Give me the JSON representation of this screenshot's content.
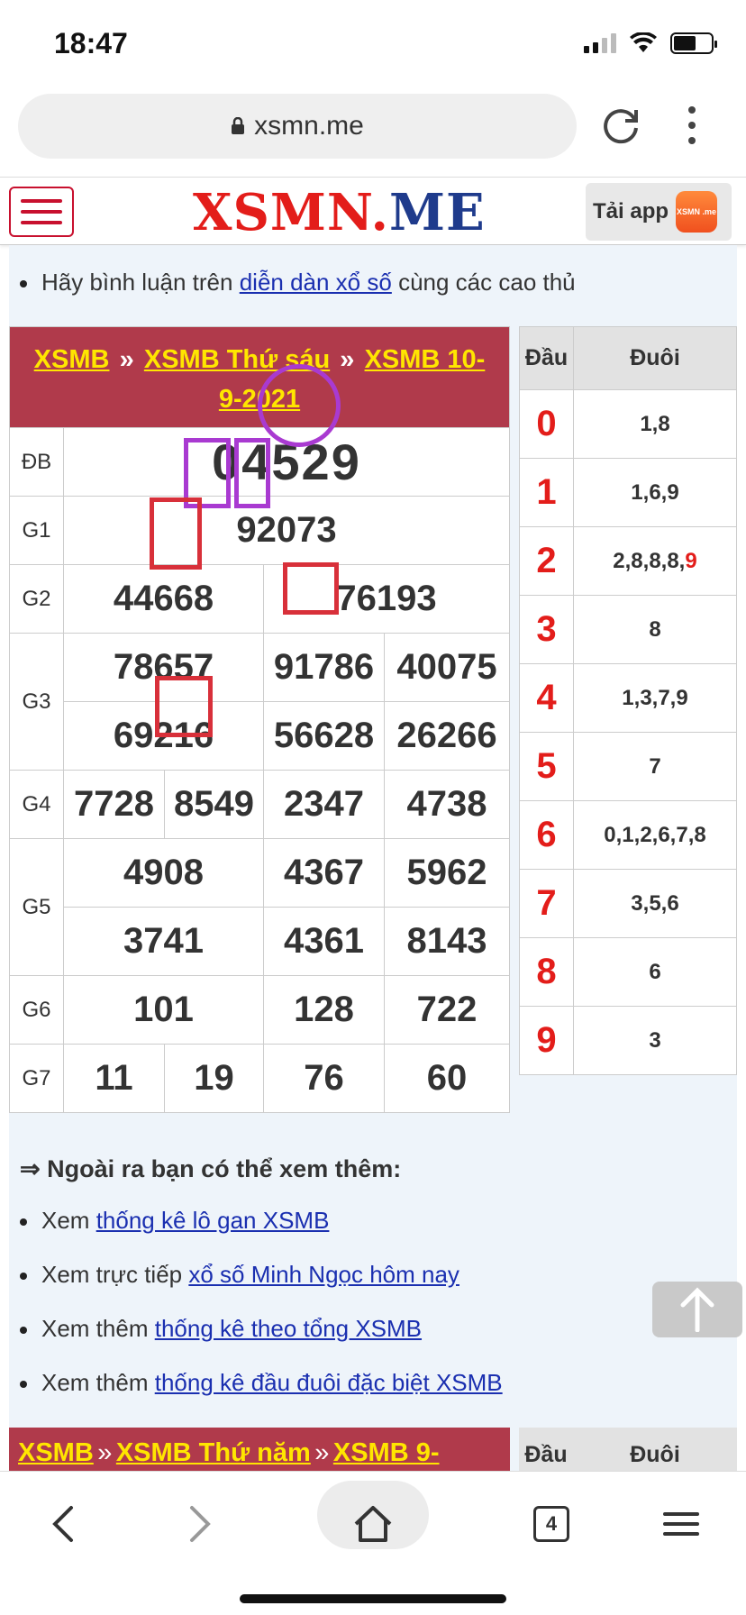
{
  "status_bar": {
    "time": "18:47"
  },
  "browser": {
    "url": "xsmn.me",
    "tab_count": "4"
  },
  "site": {
    "logo_red": "XSMN.",
    "logo_blue": "ME",
    "tai_app": "Tải app",
    "app_icon_text": "XSMN .me"
  },
  "comment": {
    "prefix": "Hãy bình luận trên ",
    "link": "diễn dàn xổ số",
    "suffix": " cùng các cao thủ"
  },
  "result": {
    "breadcrumb": [
      "XSMB",
      "XSMB Thứ sáu",
      "XSMB 10-9-2021"
    ],
    "separator": "»",
    "rows": {
      "db": {
        "label": "ĐB",
        "value": "04529"
      },
      "g1": {
        "label": "G1",
        "value": "92073"
      },
      "g2": {
        "label": "G2",
        "values": [
          "44668",
          "76193"
        ]
      },
      "g3": {
        "label": "G3",
        "values": [
          "78657",
          "91786",
          "40075",
          "69216",
          "56628",
          "26266"
        ]
      },
      "g4": {
        "label": "G4",
        "values": [
          "7728",
          "8549",
          "2347",
          "4738"
        ]
      },
      "g5": {
        "label": "G5",
        "values": [
          "4908",
          "4367",
          "5962",
          "3741",
          "4361",
          "8143"
        ]
      },
      "g6": {
        "label": "G6",
        "values": [
          "101",
          "128",
          "722"
        ]
      },
      "g7": {
        "label": "G7",
        "values": [
          "11",
          "19",
          "76",
          "60"
        ]
      }
    }
  },
  "dau_duoi": {
    "header_dau": "Đầu",
    "header_duoi": "Đuôi",
    "rows": [
      {
        "d": "0",
        "tail": "1,8"
      },
      {
        "d": "1",
        "tail": "1,6,9"
      },
      {
        "d": "2",
        "tail": "2,8,8,8,",
        "tail_red": "9"
      },
      {
        "d": "3",
        "tail": "8"
      },
      {
        "d": "4",
        "tail": "1,3,7,9"
      },
      {
        "d": "5",
        "tail": "7"
      },
      {
        "d": "6",
        "tail": "0,1,2,6,7,8"
      },
      {
        "d": "7",
        "tail": "3,5,6"
      },
      {
        "d": "8",
        "tail": "6"
      },
      {
        "d": "9",
        "tail": "3"
      }
    ]
  },
  "see_more": {
    "heading": "⇒ Ngoài ra bạn có thể xem thêm:",
    "items": [
      {
        "prefix": "Xem ",
        "link": "thống kê lô gan XSMB"
      },
      {
        "prefix": "Xem trực tiếp ",
        "link": "xổ số Minh Ngọc hôm nay"
      },
      {
        "prefix": "Xem thêm ",
        "link": "thống kê theo tổng XSMB"
      },
      {
        "prefix": "Xem thêm ",
        "link": "thống kê đầu đuôi đặc biệt XSMB"
      }
    ]
  },
  "next_card": {
    "breadcrumb": [
      "XSMB",
      "XSMB Thứ năm",
      "XSMB 9-"
    ],
    "header_dau": "Đầu",
    "header_duoi": "Đuôi"
  },
  "colors": {
    "brand_red": "#e31d1a",
    "brand_blue": "#1f3b8c",
    "card_header": "#b03a4b",
    "link_yellow": "#ffe600",
    "annotation_purple": "#a93ad1",
    "annotation_red": "#d8303a"
  },
  "icons": [
    "lock-icon",
    "reload-icon",
    "more-icon",
    "hamburger-icon",
    "scroll-top-icon",
    "back-icon",
    "forward-icon",
    "home-icon",
    "tabs-icon",
    "menu-icon"
  ]
}
